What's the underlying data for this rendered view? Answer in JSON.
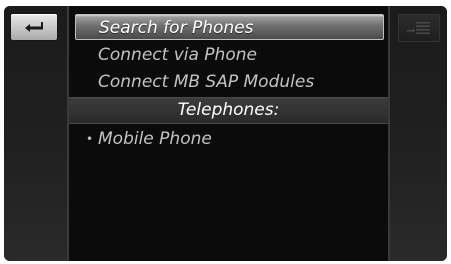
{
  "left_panel": {
    "back_icon": "back-arrow-icon"
  },
  "right_panel": {
    "list_icon": "list-menu-icon"
  },
  "menu": {
    "items": [
      {
        "label": "Search for Phones",
        "selected": true
      },
      {
        "label": "Connect via Phone",
        "selected": false
      },
      {
        "label": "Connect MB SAP Modules",
        "selected": false
      }
    ],
    "section_header": "Telephones:",
    "devices": [
      {
        "label": "Mobile Phone",
        "bullet": "•"
      }
    ]
  },
  "colors": {
    "background": "#121212",
    "selected_highlight": "#6f6f6f",
    "item_text": "#c3c3c3",
    "header_text": "#ffffff"
  }
}
